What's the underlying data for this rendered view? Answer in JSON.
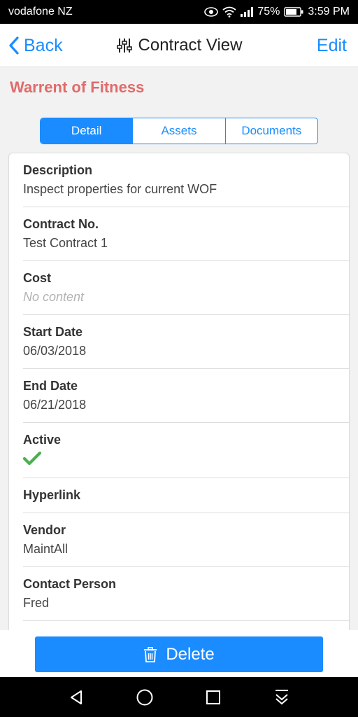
{
  "status": {
    "carrier": "vodafone NZ",
    "battery": "75%",
    "time": "3:59 PM"
  },
  "nav": {
    "back_label": "Back",
    "title": "Contract View",
    "edit_label": "Edit"
  },
  "heading": "Warrent of Fitness",
  "tabs": [
    {
      "label": "Detail",
      "active": true
    },
    {
      "label": "Assets",
      "active": false
    },
    {
      "label": "Documents",
      "active": false
    }
  ],
  "fields": {
    "description": {
      "label": "Description",
      "value": "Inspect properties for current WOF"
    },
    "contract_no": {
      "label": "Contract No.",
      "value": "Test Contract 1"
    },
    "cost": {
      "label": "Cost",
      "value": "No content"
    },
    "start_date": {
      "label": "Start Date",
      "value": "06/03/2018"
    },
    "end_date": {
      "label": "End Date",
      "value": "06/21/2018"
    },
    "active": {
      "label": "Active",
      "checked": true
    },
    "hyperlink": {
      "label": "Hyperlink"
    },
    "vendor": {
      "label": "Vendor",
      "value": "MaintAll"
    },
    "contact_person": {
      "label": "Contact Person",
      "value": "Fred"
    }
  },
  "footer": {
    "delete_label": "Delete"
  },
  "icons": {
    "back": "chevron-left-icon",
    "title": "sliders-icon",
    "delete": "trash-icon",
    "check": "checkmark-icon",
    "eye": "eye-icon",
    "wifi": "wifi-icon",
    "signal": "signal-icon",
    "battery": "battery-icon",
    "sys_back": "triangle-back-icon",
    "sys_home": "circle-home-icon",
    "sys_recent": "square-recent-icon",
    "sys_notif": "download-arrow-icon"
  },
  "colors": {
    "accent": "#1a8cff",
    "heading": "#e06b6b",
    "check": "#4caf50"
  }
}
